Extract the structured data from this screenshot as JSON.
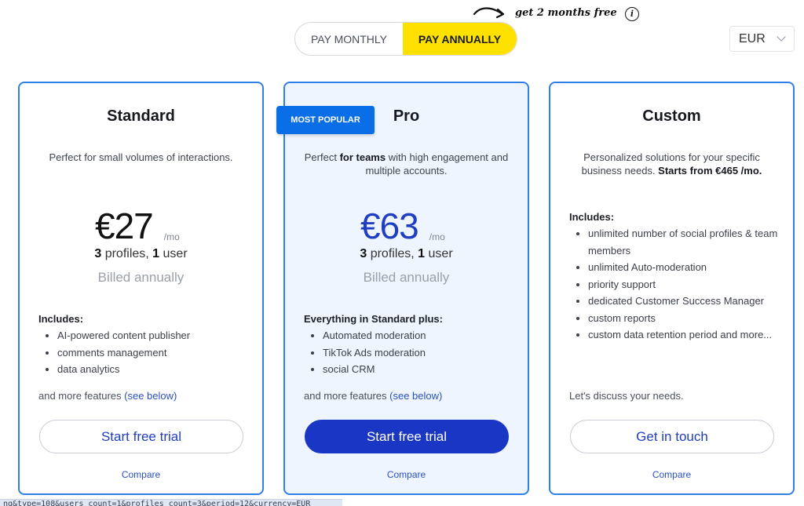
{
  "promo": {
    "text": "get 2 months free",
    "icon": "info-icon",
    "info_glyph": "i"
  },
  "billing_toggle": {
    "monthly_label": "PAY MONTHLY",
    "annual_label": "PAY ANNUALLY",
    "selected": "annual",
    "accent": "#ffe100"
  },
  "currency": {
    "value": "EUR"
  },
  "colors": {
    "card_border": "#2f80e6",
    "primary": "#1a36c4",
    "badge": "#0a6ee6",
    "pro_bg": "#eef5fe"
  },
  "plans": [
    {
      "name": "Standard",
      "description": "Perfect for small volumes of interactions.",
      "price": "€27",
      "price_unit": "/mo",
      "profiles_count": "3",
      "profiles_label": "profiles,",
      "users_count": "1",
      "users_label": "user",
      "billed": "Billed annually",
      "includes_title": "Includes:",
      "features": [
        "AI-powered content publisher",
        "comments management",
        "data analytics"
      ],
      "more_text": "and more features",
      "more_link": "(see below)",
      "cta": "Start free trial",
      "compare": "Compare"
    },
    {
      "name": "Pro",
      "badge": "MOST POPULAR",
      "description_pre": "Perfect",
      "description_bold": "for teams",
      "description_post": "with high engagement and multiple accounts.",
      "price": "€63",
      "price_unit": "/mo",
      "profiles_count": "3",
      "profiles_label": "profiles,",
      "users_count": "1",
      "users_label": "user",
      "billed": "Billed annually",
      "includes_title": "Everything in Standard plus:",
      "features": [
        "Automated moderation",
        "TikTok Ads moderation",
        "social CRM"
      ],
      "more_text": "and more features",
      "more_link": "(see below)",
      "cta": "Start free trial",
      "compare": "Compare"
    },
    {
      "name": "Custom",
      "description_pre": "Personalized solutions for your specific business needs.",
      "description_bold": "Starts from €465 /mo.",
      "includes_title": "Includes:",
      "features": [
        "unlimited number of social profiles & team members",
        "unlimited Auto-moderation",
        "priority support",
        "dedicated Customer Success Manager",
        "custom reports",
        "custom data retention period and more..."
      ],
      "more_text": "Let's discuss your needs.",
      "cta": "Get in touch",
      "compare": "Compare"
    }
  ],
  "status_bar": {
    "url_text": "ng&type=108&users_count=1&profiles_count=3&period=12&currency=EUR"
  }
}
